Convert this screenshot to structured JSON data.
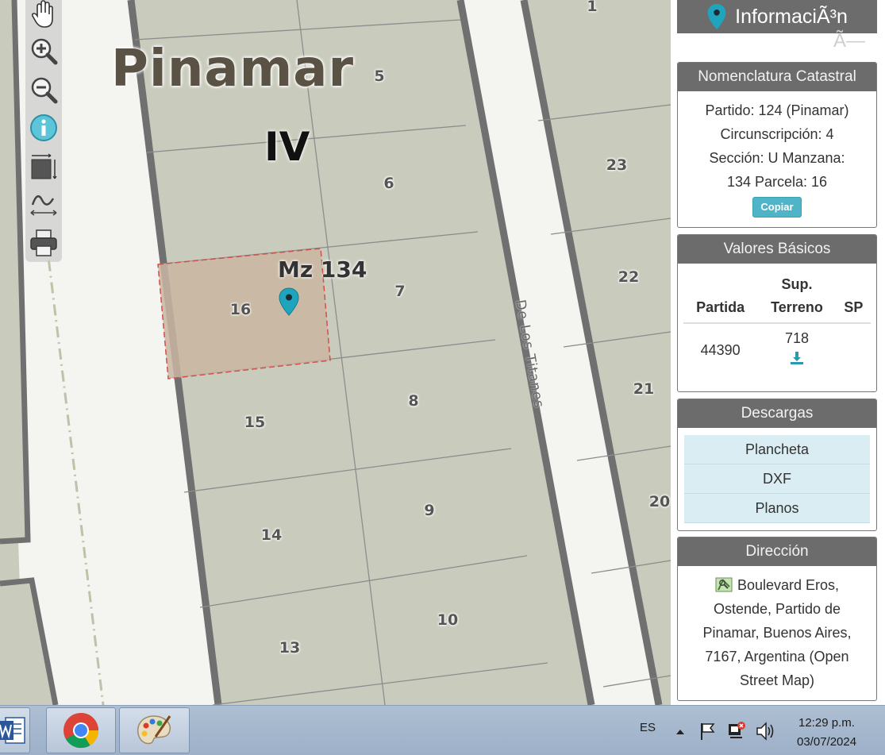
{
  "map": {
    "city": "Pinamar",
    "zone": "IV",
    "block": "Mz 134",
    "street": "De Los Titanes",
    "lots": [
      "1",
      "5",
      "6",
      "7",
      "8",
      "9",
      "10",
      "13",
      "14",
      "15",
      "16",
      "20",
      "21",
      "22",
      "23"
    ],
    "selected_lot": "16"
  },
  "panel": {
    "title": "InformaciÃ³n",
    "ghost_text": "Ã—",
    "nomenclatura": {
      "header": "Nomenclatura Catastral",
      "lines": [
        "Partido: 124 (Pinamar)",
        "Circunscripción: 4",
        "Sección: U Manzana:",
        "134 Parcela: 16"
      ],
      "copy_label": "Copiar"
    },
    "valores": {
      "header": "Valores Básicos",
      "col_partida": "Partida",
      "col_sup_line1": "Sup.",
      "col_sup_line2": "Terreno",
      "col_sp": "SP",
      "partida": "44390",
      "sup_terreno": "718"
    },
    "descargas": {
      "header": "Descargas",
      "items": [
        "Plancheta",
        "DXF",
        "Planos"
      ]
    },
    "direccion": {
      "header": "Dirección",
      "lines": [
        "Boulevard Eros,",
        "Ostende, Partido de",
        "Pinamar, Buenos Aires,",
        "7167, Argentina (Open",
        "Street Map)"
      ]
    }
  },
  "taskbar": {
    "language": "ES",
    "time": "12:29 p.m.",
    "date": "03/07/2024"
  },
  "colors": {
    "accent": "#4fb4c7",
    "header_gray": "#6c6c6c",
    "lot_fill": "#c9ccbd",
    "selected_fill": "#c9b5a1",
    "selected_border": "#d0504c"
  }
}
